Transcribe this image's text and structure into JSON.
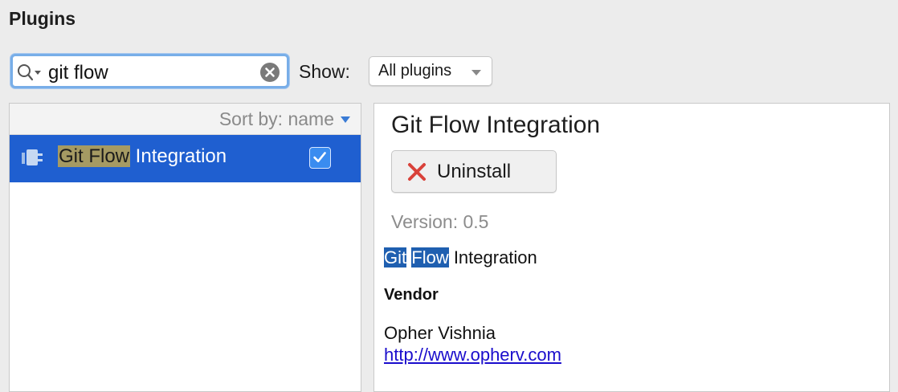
{
  "header": {
    "title": "Plugins"
  },
  "search": {
    "value": "git flow"
  },
  "filter": {
    "label": "Show:",
    "selected": "All plugins"
  },
  "list": {
    "sort_label": "Sort by: name",
    "items": [
      {
        "highlight": "Git Flow",
        "rest": " Integration",
        "enabled": true,
        "selected": true
      }
    ]
  },
  "detail": {
    "title": "Git Flow Integration",
    "uninstall_label": "Uninstall",
    "version": "Version: 0.5",
    "description": {
      "word1": "Git",
      "word2": "Flow",
      "rest": " Integration"
    },
    "vendor_heading": "Vendor",
    "vendor_name": "Opher Vishnia",
    "vendor_url": "http://www.opherv.com"
  },
  "colors": {
    "selection_blue": "#1f5fd0",
    "search_focus": "#78aee8",
    "match_highlight": "#a59a63",
    "uninstall_x": "#d9423a",
    "link": "#1a0dcc"
  },
  "icons": [
    "search-icon",
    "clear-icon",
    "chevron-down-icon",
    "plugin-icon",
    "checkbox-checked-icon",
    "close-x-icon"
  ]
}
